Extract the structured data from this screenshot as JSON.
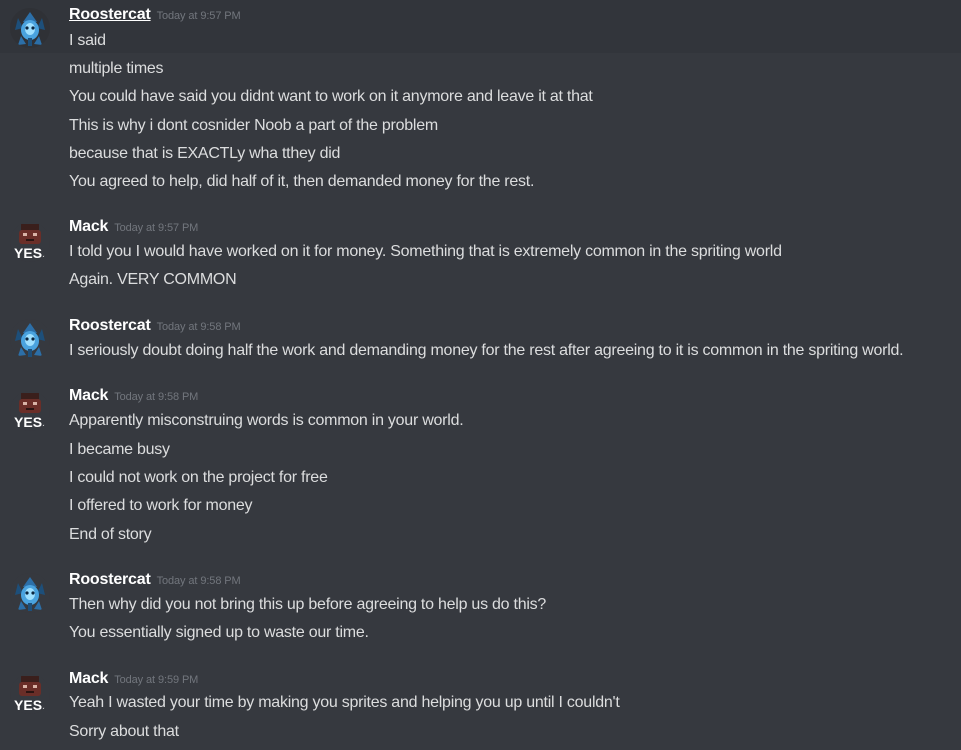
{
  "groups": [
    {
      "author": "Roostercat",
      "timestamp": "Today at 9:57 PM",
      "avatar_icon": "robot-cat-avatar-icon",
      "messages": [
        "I said",
        "multiple times",
        "You could have said you didnt want to work on it anymore and leave it at that",
        "This is why i dont cosnider Noob a part of the problem",
        "because that is EXACTLy wha tthey did",
        "You agreed to help, did half of it, then demanded money for the rest."
      ]
    },
    {
      "author": "Mack",
      "timestamp": "Today at 9:57 PM",
      "avatar_icon": "yes-avatar-icon",
      "avatar_text": "YES.",
      "messages": [
        "I told you I would have worked on it for money. Something that is extremely common in the spriting world",
        "Again. VERY COMMON"
      ]
    },
    {
      "author": "Roostercat",
      "timestamp": "Today at 9:58 PM",
      "avatar_icon": "robot-cat-avatar-icon",
      "messages": [
        "I seriously doubt doing half the work and demanding money for the rest after agreeing to it is common in the spriting world."
      ]
    },
    {
      "author": "Mack",
      "timestamp": "Today at 9:58 PM",
      "avatar_icon": "yes-avatar-icon",
      "avatar_text": "YES.",
      "messages": [
        "Apparently misconstruing words is common in your world.",
        "I became busy",
        "I could not work on the project for free",
        "I offered to work for money",
        "End of story"
      ]
    },
    {
      "author": "Roostercat",
      "timestamp": "Today at 9:58 PM",
      "avatar_icon": "robot-cat-avatar-icon",
      "messages": [
        "Then why did you not bring this up before agreeing to help us do this?",
        "You essentially signed up to waste our time."
      ]
    },
    {
      "author": "Mack",
      "timestamp": "Today at 9:59 PM",
      "avatar_icon": "yes-avatar-icon",
      "avatar_text": "YES.",
      "messages": [
        "Yeah I wasted your time by making you sprites and helping you up until I couldn't",
        "Sorry about that"
      ]
    }
  ],
  "colors": {
    "background": "#36393f",
    "highlight": "#32353b",
    "username": "#ffffff",
    "timestamp": "#72767d",
    "message": "#dcddde"
  }
}
